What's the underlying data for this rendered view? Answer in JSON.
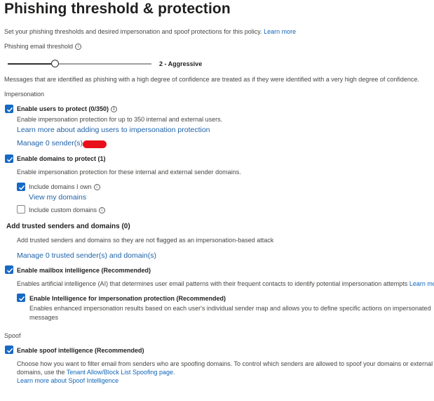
{
  "header": {
    "title": "Phishing threshold & protection",
    "intro": "Set your phishing thresholds and desired impersonation and spoof protections for this policy.",
    "intro_link": "Learn more"
  },
  "threshold": {
    "label": "Phishing email threshold",
    "value_label": "2 - Aggressive",
    "value": 2,
    "min": 1,
    "max": 4,
    "description": "Messages that are identified as phishing with a high degree of confidence are treated as if they were identified with a very high degree of confidence."
  },
  "impersonation": {
    "section_label": "Impersonation",
    "users": {
      "checked": true,
      "label": "Enable users to protect (0/350)",
      "description": "Enable impersonation protection for up to 350 internal and external users.",
      "learn_link": "Learn more about adding users to impersonation protection",
      "manage_link": "Manage 0 sender(s)"
    },
    "domains": {
      "checked": true,
      "label": "Enable domains to protect (1)",
      "description": "Enable impersonation protection for these internal and external sender domains.",
      "own": {
        "checked": true,
        "label": "Include domains I own",
        "view_link": "View my domains"
      },
      "custom": {
        "checked": false,
        "label": "Include custom domains"
      }
    }
  },
  "trusted": {
    "heading": "Add trusted senders and domains (0)",
    "description": "Add trusted senders and domains so they are not flagged as an impersonation-based attack",
    "manage_link": "Manage 0 trusted sender(s) and domain(s)"
  },
  "mailbox": {
    "checked": true,
    "label": "Enable mailbox intelligence (Recommended)",
    "description": "Enables artificial intelligence (AI) that determines user email patterns with their frequent contacts to identify potential impersonation attempts",
    "learn_link": "Learn more",
    "intel": {
      "checked": true,
      "label": "Enable Intelligence for impersonation protection (Recommended)",
      "desc_line1": "Enables enhanced impersonation results based on each user's individual sender map and allows you to define specific actions on impersonated",
      "desc_line2": "messages"
    }
  },
  "spoof": {
    "section_label": "Spoof",
    "checked": true,
    "label": "Enable spoof intelligence (Recommended)",
    "desc_line1": "Choose how you want to filter email from senders who are spoofing domains. To control which senders are allowed to spoof your domains or external",
    "desc_line2": "domains, use the",
    "tenant_link": "Tenant Allow/Block List Spoofing page",
    "period": ".",
    "learn_link": "Learn more about Spoof Intelligence"
  },
  "colors": {
    "accent": "#1769c4",
    "link": "#1066b8",
    "redaction": "#e8111b"
  }
}
